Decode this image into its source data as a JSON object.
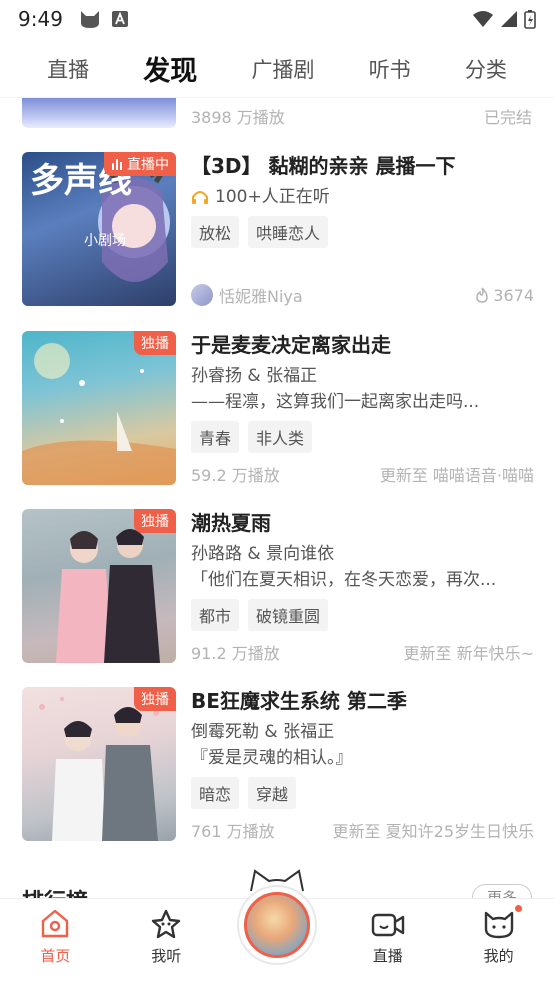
{
  "status_bar": {
    "time": "9:49"
  },
  "top_tabs": [
    {
      "label": "直播",
      "active": false
    },
    {
      "label": "发现",
      "active": true
    },
    {
      "label": "广播剧",
      "active": false
    },
    {
      "label": "听书",
      "active": false
    },
    {
      "label": "分类",
      "active": false
    }
  ],
  "partial_item": {
    "plays": "3898 万播放",
    "status": "已完结"
  },
  "cards": [
    {
      "badge": "直播中",
      "cover_text": "多声线",
      "cover_sub": "小剧场",
      "title": "【3D】 黏糊的亲亲 晨播一下",
      "listening": "100+人正在听",
      "tags": [
        "放松",
        "哄睡恋人"
      ],
      "host": "恬妮雅Niya",
      "heat": "3674"
    },
    {
      "badge": "独播",
      "title": "于是麦麦决定离家出走",
      "cv": "孙睿扬 & 张福正",
      "desc": "——程凛，这算我们一起离家出走吗...",
      "tags": [
        "青春",
        "非人类"
      ],
      "plays": "59.2 万播放",
      "update": "更新至 喵喵语音·喵喵"
    },
    {
      "badge": "独播",
      "title": "潮热夏雨",
      "cv": "孙路路 & 景向谁依",
      "desc": "「他们在夏天相识，在冬天恋爱，再次...",
      "tags": [
        "都市",
        "破镜重圆"
      ],
      "plays": "91.2 万播放",
      "update": "更新至 新年快乐~"
    },
    {
      "badge": "独播",
      "title": "BE狂魔求生系统 第二季",
      "cv": "倒霉死勒 & 张福正",
      "desc": "『爱是灵魂的相认。』",
      "tags": [
        "暗恋",
        "穿越"
      ],
      "plays": "761 万播放",
      "update": "更新至 夏知许25岁生日快乐"
    }
  ],
  "rank": {
    "title": "排行榜",
    "more": "更多"
  },
  "bottom_nav": [
    {
      "label": "首页",
      "icon": "home-icon",
      "active": true
    },
    {
      "label": "我听",
      "icon": "star-icon",
      "active": false
    },
    {
      "label": "直播",
      "icon": "video-icon",
      "active": false
    },
    {
      "label": "我的",
      "icon": "cat-icon",
      "active": false
    }
  ],
  "colors": {
    "accent": "#f05f47",
    "muted_text": "#b3b3b3",
    "tag_bg": "#f3f3f3"
  }
}
